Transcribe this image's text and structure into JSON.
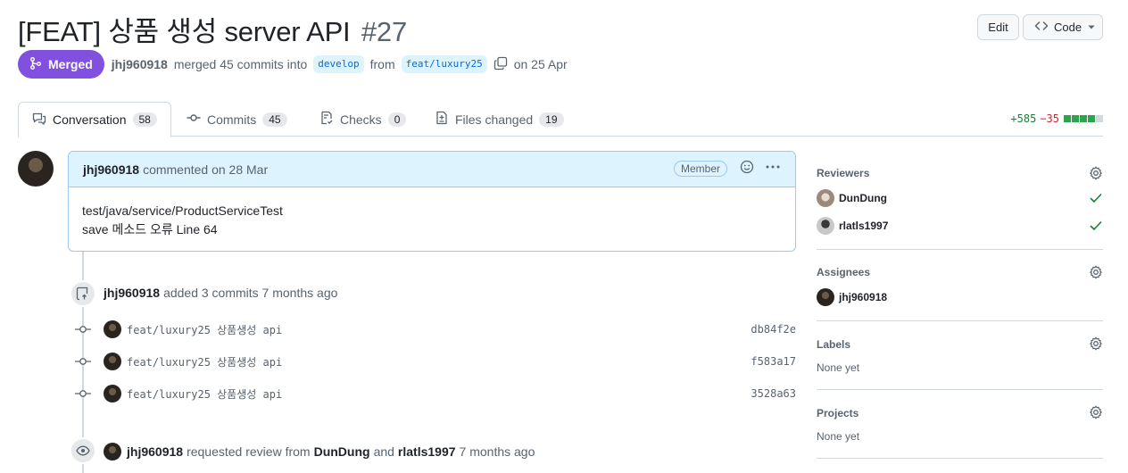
{
  "header": {
    "title": "[FEAT] 상품 생성 server API",
    "number": "#27",
    "edit_label": "Edit",
    "code_label": "Code"
  },
  "meta": {
    "state_label": "Merged",
    "author": "jhj960918",
    "merged_text": "merged 45 commits into",
    "base_branch": "develop",
    "from_text": "from",
    "head_branch": "feat/luxury25",
    "date_text": "on 25 Apr"
  },
  "tabs": [
    {
      "label": "Conversation",
      "count": "58",
      "icon": "comment-discussion-icon"
    },
    {
      "label": "Commits",
      "count": "45",
      "icon": "git-commit-icon"
    },
    {
      "label": "Checks",
      "count": "0",
      "icon": "checklist-icon"
    },
    {
      "label": "Files changed",
      "count": "19",
      "icon": "file-diff-icon"
    }
  ],
  "diffstat": {
    "additions": "+585",
    "deletions": "−35",
    "colors": {
      "add": "#2da44e",
      "neutral": "#d1d9e0"
    }
  },
  "comment": {
    "author": "jhj960918",
    "action": "commented on 28 Mar",
    "role": "Member",
    "body_line1": "test/java/service/ProductServiceTest",
    "body_line2": "save 메소드 오류 Line 64"
  },
  "commits_event": {
    "author": "jhj960918",
    "text": "added 3 commits 7 months ago",
    "commits": [
      {
        "message": "feat/luxury25 상품생성 api",
        "sha": "db84f2e"
      },
      {
        "message": "feat/luxury25 상품생성 api",
        "sha": "f583a17"
      },
      {
        "message": "feat/luxury25 상품생성 api",
        "sha": "3528a63"
      }
    ]
  },
  "review_event": {
    "author": "jhj960918",
    "text1": "requested review from",
    "reviewer1": "DunDung",
    "and_text": "and",
    "reviewer2": "rlatls1997",
    "time": "7 months ago"
  },
  "sidebar": {
    "reviewers_label": "Reviewers",
    "reviewers": [
      {
        "name": "DunDung",
        "status": "approved"
      },
      {
        "name": "rlatls1997",
        "status": "approved"
      }
    ],
    "assignees_label": "Assignees",
    "assignees": [
      {
        "name": "jhj960918"
      }
    ],
    "labels_label": "Labels",
    "labels_value": "None yet",
    "projects_label": "Projects",
    "projects_value": "None yet"
  },
  "colors": {
    "merged": "#8250df",
    "link": "#0969da",
    "success": "#1a7f37"
  }
}
